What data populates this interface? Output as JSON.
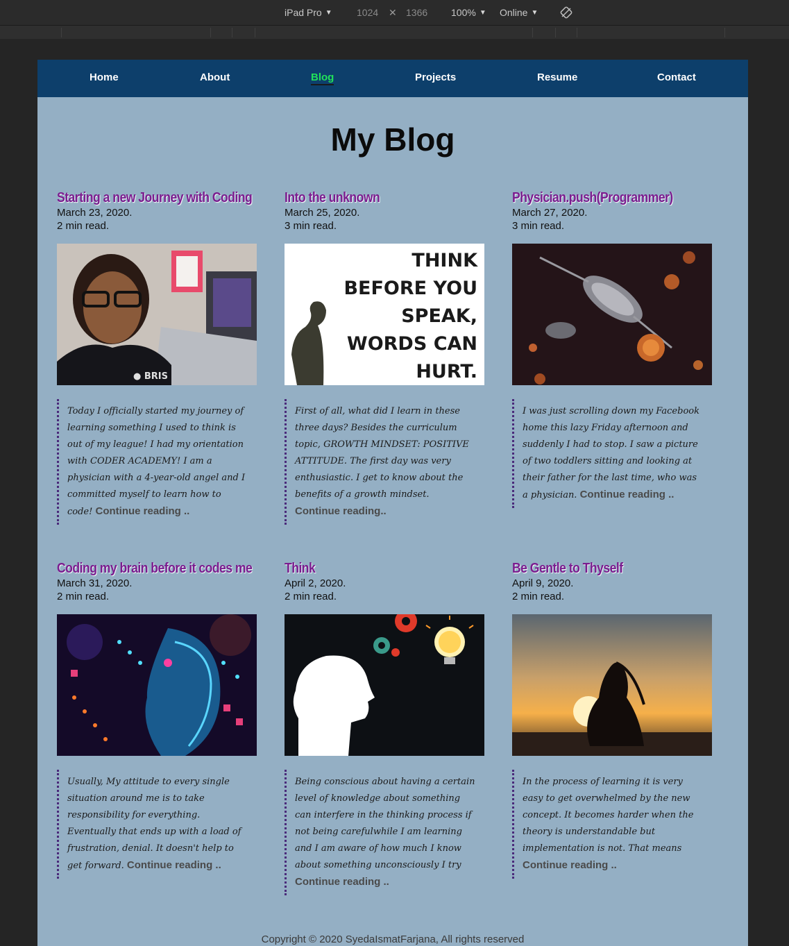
{
  "devtools": {
    "device": "iPad Pro",
    "width": "1024",
    "height": "1366",
    "zoom": "100%",
    "network": "Online"
  },
  "nav": {
    "items": [
      "Home",
      "About",
      "Blog",
      "Projects",
      "Resume",
      "Contact"
    ],
    "active": "Blog"
  },
  "page_title": "My Blog",
  "posts": [
    {
      "title": "Starting a new Journey with Coding",
      "date": "March 23, 2020.",
      "read": "2 min read.",
      "excerpt": "Today I officially started my journey of learning something I used to think is out of my league! I had my orientation with CODER ACADEMY! I am a physician with a 4-year-old angel and I committed myself to learn how to code!",
      "more": "Continue reading ..",
      "image": "selfie-photo"
    },
    {
      "title": "Into the unknown",
      "date": "March 25, 2020.",
      "read": "3 min read.",
      "excerpt": "First of all, what did I learn in these three days? Besides the curriculum topic, GROWTH MINDSET: POSITIVE ATTITUDE. The first day was very enthusiastic. I get to know about the benefits of a growth mindset.",
      "more": "Continue reading..",
      "image": "quote-poster",
      "image_text": [
        "THINK",
        "BEFORE YOU",
        "SPEAK,",
        "WORDS CAN",
        "HURT."
      ]
    },
    {
      "title": "Physician.push(Programmer)",
      "date": "March 27, 2020.",
      "read": "3 min read.",
      "excerpt": "I was just scrolling down my Facebook home this lazy Friday afternoon and suddenly I had to stop. I saw a picture of two toddlers sitting and looking at their father for the last time, who was a physician.",
      "more": "Continue reading ..",
      "image": "virus-illustration"
    },
    {
      "title": "Coding my brain before it codes me",
      "date": "March 31, 2020.",
      "read": "2 min read.",
      "excerpt": "Usually, My attitude to every single situation around me is to take responsibility for everything. Eventually that ends up with a load of frustration, denial. It doesn't help to get forward.",
      "more": "Continue reading ..",
      "image": "neon-brain-circuit"
    },
    {
      "title": "Think",
      "date": "April 2, 2020.",
      "read": "2 min read.",
      "excerpt": "Being conscious about having a certain level of knowledge about something can interfere in the thinking process if not being carefulwhile I am learning and I am aware of how much I know about something unconsciously I try",
      "more": "Continue reading ..",
      "image": "head-lightbulb"
    },
    {
      "title": "Be Gentle to Thyself",
      "date": "April 9, 2020.",
      "read": "2 min read.",
      "excerpt": "In the process of learning it is very easy to get overwhelmed by the new concept. It becomes harder when the theory is understandable but implementation is not. That means",
      "more": "Continue reading ..",
      "image": "sunset-silhouette"
    }
  ],
  "footer": "Copyright © 2020 SyedaIsmatFarjana, All rights reserved",
  "colors": {
    "nav_bg": "#0d3f6b",
    "page_bg": "#94afc4",
    "active_link": "#21e05a",
    "title_purple": "#7a1d8f"
  }
}
